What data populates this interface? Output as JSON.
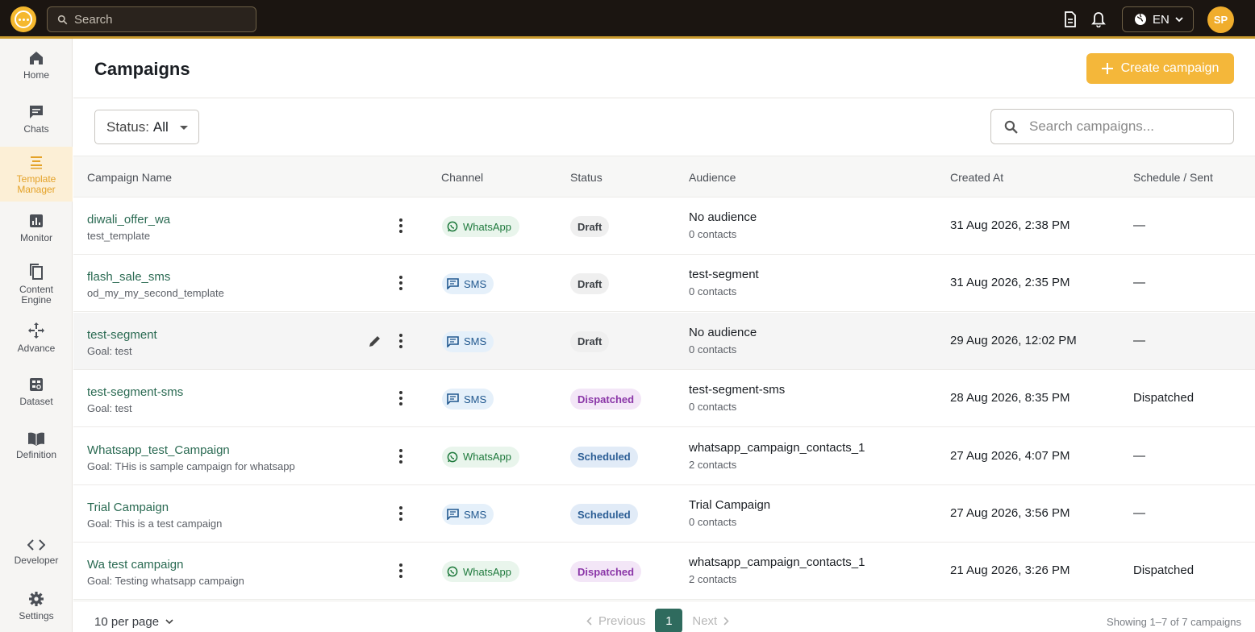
{
  "topbar": {
    "search_placeholder": "Search",
    "language": "EN",
    "avatar_initials": "SP"
  },
  "sidebar": {
    "items": [
      {
        "label": "Home",
        "icon": "home-icon"
      },
      {
        "label": "Chats",
        "icon": "chat-icon"
      },
      {
        "label": "Template Manager",
        "icon": "template-icon",
        "active": true
      },
      {
        "label": "Monitor",
        "icon": "chart-icon"
      },
      {
        "label": "Content Engine",
        "icon": "copy-icon"
      },
      {
        "label": "Advance",
        "icon": "advance-icon"
      },
      {
        "label": "Dataset",
        "icon": "dataset-icon"
      },
      {
        "label": "Definition",
        "icon": "book-icon"
      }
    ],
    "bottom_items": [
      {
        "label": "Developer",
        "icon": "code-icon"
      },
      {
        "label": "Settings",
        "icon": "gear-icon"
      }
    ]
  },
  "page": {
    "title": "Campaigns",
    "create_label": "Create campaign",
    "status_filter_label": "Status:",
    "status_filter_value": "All",
    "search_placeholder": "Search campaigns..."
  },
  "table": {
    "headers": [
      "Campaign Name",
      "Channel",
      "Status",
      "Audience",
      "Created At",
      "Schedule / Sent"
    ],
    "rows": [
      {
        "name": "diwali_offer_wa",
        "sub": "test_template",
        "channel": "WhatsApp",
        "status": "Draft",
        "audience": "No audience",
        "contacts": "0 contacts",
        "created": "31 Aug 2026, 2:38 PM",
        "sent": "—"
      },
      {
        "name": "flash_sale_sms",
        "sub": "od_my_my_second_template",
        "channel": "SMS",
        "status": "Draft",
        "audience": "test-segment",
        "contacts": "0 contacts",
        "created": "31 Aug 2026, 2:35 PM",
        "sent": "—"
      },
      {
        "name": "test-segment",
        "sub": "Goal: test",
        "channel": "SMS",
        "status": "Draft",
        "audience": "No audience",
        "contacts": "0 contacts",
        "created": "29 Aug 2026, 12:02 PM",
        "sent": "—"
      },
      {
        "name": "test-segment-sms",
        "sub": "Goal: test",
        "channel": "SMS",
        "status": "Dispatched",
        "audience": "test-segment-sms",
        "contacts": "0 contacts",
        "created": "28 Aug 2026, 8:35 PM",
        "sent": "Dispatched"
      },
      {
        "name": "Whatsapp_test_Campaign",
        "sub": "Goal: THis is sample campaign for whatsapp",
        "channel": "WhatsApp",
        "status": "Scheduled",
        "audience": "whatsapp_campaign_contacts_1",
        "contacts": "2 contacts",
        "created": "27 Aug 2026, 4:07 PM",
        "sent": "—"
      },
      {
        "name": "Trial Campaign",
        "sub": "Goal: This is a test campaign",
        "channel": "SMS",
        "status": "Scheduled",
        "audience": "Trial Campaign",
        "contacts": "0 contacts",
        "created": "27 Aug 2026, 3:56 PM",
        "sent": "—"
      },
      {
        "name": "Wa test campaign",
        "sub": "Goal: Testing whatsapp campaign",
        "channel": "WhatsApp",
        "status": "Dispatched",
        "audience": "whatsapp_campaign_contacts_1",
        "contacts": "2 contacts",
        "created": "21 Aug 2026, 3:26 PM",
        "sent": "Dispatched"
      }
    ]
  },
  "footer": {
    "per_page": "10 per page",
    "previous": "Previous",
    "page": "1",
    "next": "Next",
    "showing": "Showing 1–7 of 7 campaigns"
  },
  "colors": {
    "accent": "#f4b73a",
    "link": "#2a6a52",
    "topbar": "#1b1511",
    "page_active": "#2f6b5e"
  }
}
